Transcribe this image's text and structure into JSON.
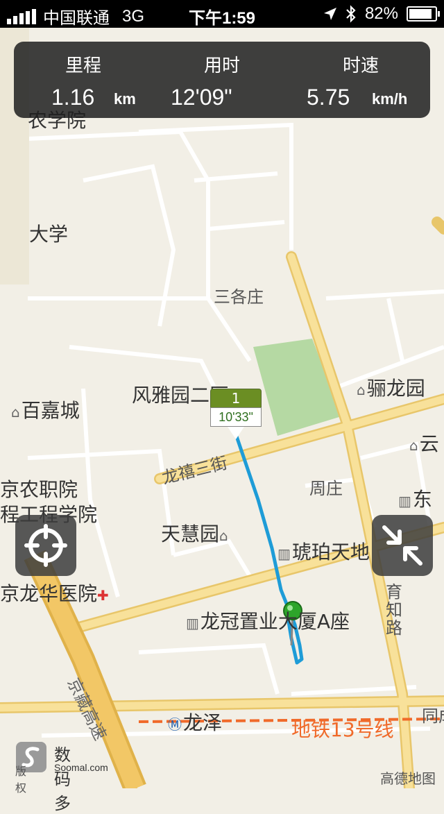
{
  "status_bar": {
    "carrier": "中国联通",
    "network": "3G",
    "time": "下午1:59",
    "battery": "82%"
  },
  "stats": {
    "distance": {
      "title": "里程",
      "value": "1.16",
      "unit": "km"
    },
    "duration": {
      "title": "用时",
      "value": "12'09\""
    },
    "speed": {
      "title": "时速",
      "value": "5.75",
      "unit": "km/h"
    }
  },
  "km_marker": {
    "number": "1",
    "split_time": "10'33\""
  },
  "map_labels": {
    "nongxueyuan": "农学院",
    "daxue": "大学",
    "sangezhuang": "三各庄",
    "fengyayuan": "风雅园二区",
    "lilongyuan": "骊龙园",
    "baijiacheng": "百嘉城",
    "yun": "云",
    "longxisanjie": "龙禧三街",
    "zhouzhuang": "周庄",
    "jingnongzhiyuan": "京农职院",
    "gongchengxueyuan": "程工程学院",
    "dong": "东",
    "tianhuiyuan": "天慧园",
    "hupotiandi": "琥珀天地",
    "longhuayiyuan": "京龙华医院",
    "yuzhilu": "育知路",
    "longguan": "龙冠置业大厦A座",
    "jingzanggaosu": "京藏高速",
    "longze": "龙泽",
    "subway13": "地铁13号线",
    "tongcheng": "同成"
  },
  "watermark": {
    "brand": "数码多",
    "domain": "Soomal.com",
    "copyright": "版权"
  },
  "map_provider": "高德地图",
  "colors": {
    "route": "#1e9cd7",
    "road_major": "#f5da86",
    "road_minor": "#ffffff",
    "park": "#b5d9a3",
    "marker_green": "#6b8e23",
    "subway": "#f06a2a"
  },
  "icons": {
    "locate": "crosshair-icon",
    "collapse": "collapse-arrows-icon",
    "location_arrow": "location-arrow-icon",
    "bluetooth": "bluetooth-icon"
  }
}
